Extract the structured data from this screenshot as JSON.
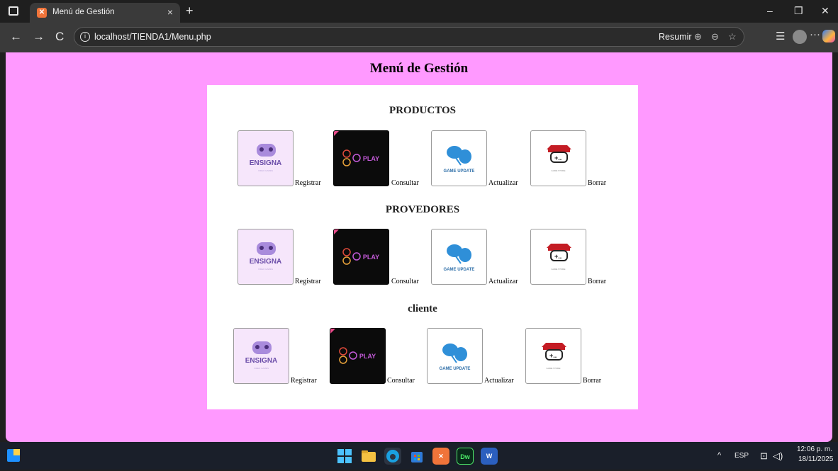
{
  "browser": {
    "tab_title": "Menú de Gestión",
    "tab_close": "×",
    "new_tab": "+",
    "url": "localhost/TIENDA1/Menu.php",
    "resumir": "Resumir",
    "window_controls": {
      "minimize": "–",
      "restore": "❐",
      "close": "✕"
    },
    "nav": {
      "back": "←",
      "forward": "→",
      "reload": "C"
    },
    "more": "···"
  },
  "page": {
    "title": "Menú de Gestión",
    "thumb_text": {
      "ensigna": "ENSIGNA",
      "ensigna_sub": "VIDEO GAMES",
      "play": "PLAY",
      "game_update": "GAME UPDATE",
      "store_caption": "GAME STORE"
    },
    "sections": [
      {
        "title": "PRODUCTOS",
        "actions": [
          "Registrar",
          "Consultar",
          "Actualizar",
          "Borrar"
        ]
      },
      {
        "title": "PROVEDORES",
        "actions": [
          "Registrar",
          "Consultar",
          "Actualizar",
          "Borrar"
        ]
      },
      {
        "title": "cliente",
        "actions": [
          "Registrar",
          "Consultar",
          "Actualizar",
          "Borrar"
        ]
      }
    ]
  },
  "taskbar": {
    "language": "ESP",
    "time": "12:06 p. m.",
    "date": "18/11/2025",
    "tray_chevron": "^",
    "dw_label": "Dw",
    "word_label": "W"
  },
  "colors": {
    "page_background": "#ff99ff",
    "card_background": "#ffffff",
    "browser_chrome": "#3a3a3a"
  }
}
